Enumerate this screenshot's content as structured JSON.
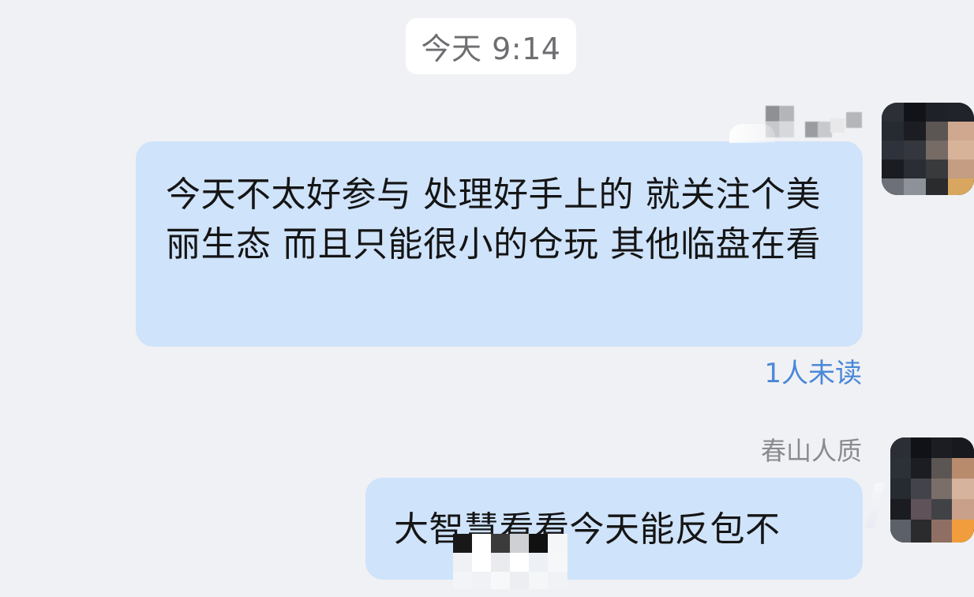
{
  "header": {
    "time": "今天 9:14"
  },
  "messages": [
    {
      "sender": "",
      "text": "今天不太好参与 处理好手上的 就关注个美丽生态 而且只能很小的仓玩 其他临盘在看",
      "read_status": "1人未读"
    },
    {
      "sender": "春山人质",
      "text": "大智慧看看今天能反包不",
      "read_status": ""
    }
  ],
  "icons": {
    "avatar_1": "person-avatar-icon",
    "avatar_2": "person-avatar-icon"
  },
  "colors": {
    "background": "#f0f1f4",
    "bubble": "#cfe3fb",
    "read_status": "#4a88d8",
    "time_pill": "#ffffff"
  }
}
